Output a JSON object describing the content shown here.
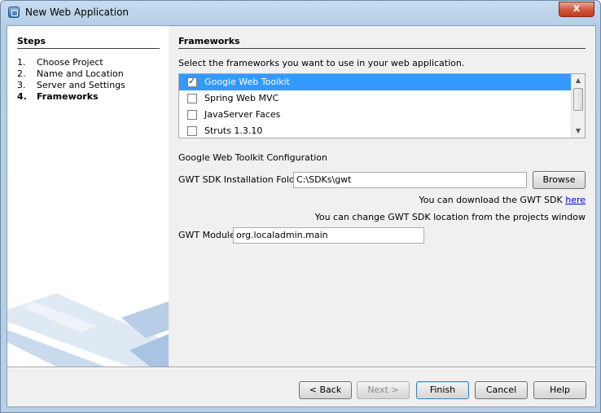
{
  "window": {
    "title": "New Web Application",
    "close_label": "x"
  },
  "steps": {
    "title": "Steps",
    "items": [
      {
        "num": "1.",
        "label": "Choose Project"
      },
      {
        "num": "2.",
        "label": "Name and Location"
      },
      {
        "num": "3.",
        "label": "Server and Settings"
      },
      {
        "num": "4.",
        "label": "Frameworks"
      }
    ]
  },
  "frameworks": {
    "title": "Frameworks",
    "instruction": "Select the frameworks you want to use in your web application.",
    "items": [
      {
        "label": "Google Web Toolkit",
        "checked": true,
        "selected": true
      },
      {
        "label": "Spring Web MVC",
        "checked": false,
        "selected": false
      },
      {
        "label": "JavaServer Faces",
        "checked": false,
        "selected": false
      },
      {
        "label": "Struts 1.3.10",
        "checked": false,
        "selected": false
      }
    ]
  },
  "gwt_config": {
    "section_title": "Google Web Toolkit Configuration",
    "sdk_folder_label": "GWT SDK Installation Folder:",
    "sdk_folder_value": "C:\\SDKs\\gwt",
    "browse_label": "Browse",
    "download_text": "You can download the GWT SDK",
    "download_link": "here",
    "change_location_text": "You can change GWT SDK location from the projects window",
    "module_label": "GWT Module:",
    "module_value": "org.localadmin.main"
  },
  "footer": {
    "back_label": "< Back",
    "next_label": "Next >",
    "finish_label": "Finish",
    "cancel_label": "Cancel",
    "help_label": "Help"
  },
  "colors": {
    "selection": "#3399ff",
    "link": "#0000ff",
    "close": "#c2381c"
  }
}
